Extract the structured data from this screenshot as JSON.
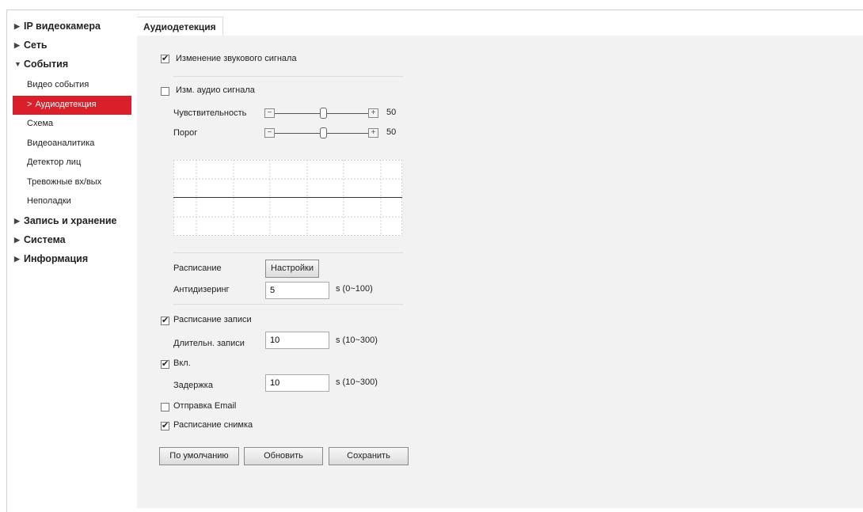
{
  "sidebar": {
    "sections": [
      {
        "label": "IP видеокамера",
        "expanded": false
      },
      {
        "label": "Сеть",
        "expanded": false
      },
      {
        "label": "События",
        "expanded": true
      },
      {
        "label": "Запись и хранение",
        "expanded": false
      },
      {
        "label": "Система",
        "expanded": false
      },
      {
        "label": "Информация",
        "expanded": false
      }
    ],
    "events_items": [
      "Видео события",
      "Аудиодетекция",
      "Схема",
      "Видеоаналитика",
      "Детектор лиц",
      "Тревожные вх/вых",
      "Неполадки"
    ],
    "active_item": "Аудиодетекция"
  },
  "tab": {
    "label": "Аудиодетекция"
  },
  "form": {
    "sound_change": {
      "label": "Изменение звукового сигнала",
      "checked": true
    },
    "audio_change": {
      "label": "Изм. аудио сигнала",
      "checked": false
    },
    "sensitivity": {
      "label": "Чувствительность",
      "value": "50"
    },
    "threshold": {
      "label": "Порог",
      "value": "50"
    },
    "schedule": {
      "label": "Расписание",
      "button": "Настройки"
    },
    "antidither": {
      "label": "Антидизеринг",
      "value": "5",
      "range": "s (0~100)"
    },
    "record_schedule": {
      "label": "Расписание записи",
      "checked": true
    },
    "record_duration": {
      "label": "Длительн. записи",
      "value": "10",
      "range": "s (10~300)"
    },
    "enable": {
      "label": "Вкл.",
      "checked": true
    },
    "delay": {
      "label": "Задержка",
      "value": "10",
      "range": "s (10~300)"
    },
    "send_email": {
      "label": "Отправка Email",
      "checked": false
    },
    "snapshot_schedule": {
      "label": "Расписание снимка",
      "checked": true
    }
  },
  "buttons": {
    "default": "По умолчанию",
    "refresh": "Обновить",
    "save": "Сохранить"
  },
  "colors": {
    "active_bg": "#d9202a",
    "panel_bg": "#f2f2f2"
  }
}
